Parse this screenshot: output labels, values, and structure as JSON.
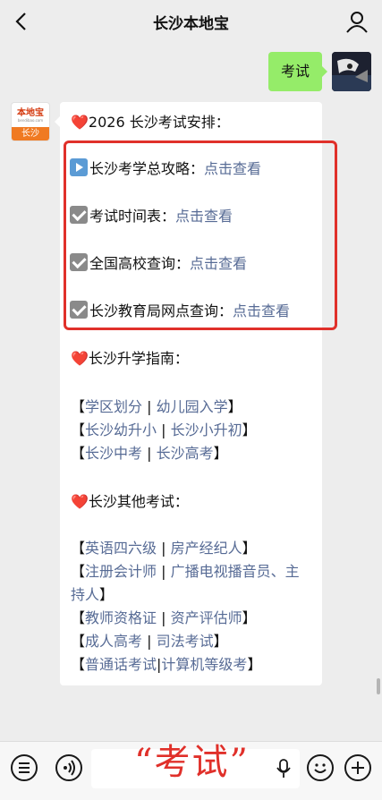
{
  "header": {
    "title": "长沙本地宝"
  },
  "outgoing": {
    "text": "考试"
  },
  "bot": {
    "logo_text": "本地宝",
    "logo_url": "bendibao.com",
    "logo_city": "长沙"
  },
  "message": {
    "heading": "❤️2026 长沙考试安排：",
    "items": [
      {
        "label": "长沙考学总攻略：",
        "link": "点击查看",
        "icon": "play-icon"
      },
      {
        "label": "考试时间表：",
        "link": "点击查看",
        "icon": "check-icon"
      },
      {
        "label": "全国高校查询：",
        "link": "点击查看",
        "icon": "check-icon"
      },
      {
        "label": "长沙教育局网点查询：",
        "link": "点击查看",
        "icon": "check-icon"
      }
    ],
    "guide_heading": "❤️长沙升学指南：",
    "guide_links": [
      [
        "学区划分",
        "幼儿园入学"
      ],
      [
        "长沙幼升小",
        "长沙小升初"
      ],
      [
        "长沙中考",
        "长沙高考"
      ]
    ],
    "other_heading": "❤️长沙其他考试：",
    "other_links": {
      "l1": [
        "英语四六级",
        "房产经纪人"
      ],
      "l2a": "注册会计师",
      "l2b": "广播电视播音员、主",
      "l2c": "持人",
      "l3": [
        "教师资格证",
        "资产评估师"
      ],
      "l4": [
        "成人高考",
        "司法考试"
      ],
      "l5": [
        "普通话考试",
        "计算机等级考"
      ]
    }
  },
  "bottom": {
    "overlay": "“考试”"
  },
  "colors": {
    "accent_green": "#95ec69",
    "link_blue": "#576b95",
    "highlight_red": "#e0302a"
  }
}
